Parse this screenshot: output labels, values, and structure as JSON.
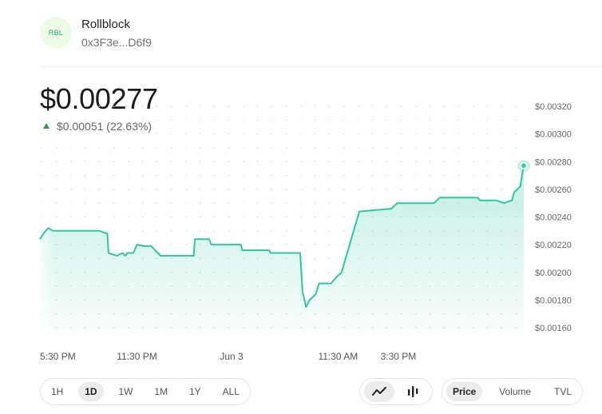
{
  "token": {
    "logo_text": "RBL",
    "name": "Rollblock",
    "address": "0x3F3e...D6f9"
  },
  "price": {
    "value": "$0.00277",
    "change": "$0.00051 (22.63%)",
    "change_direction": "up"
  },
  "colors": {
    "accent": "#2fc7a0",
    "positive": "#2d9c46"
  },
  "chart_data": {
    "type": "line",
    "title": "",
    "xlabel": "",
    "ylabel": "",
    "ylim": [
      0.00155,
      0.00325
    ],
    "y_ticks": [
      "$0.00320",
      "$0.00300",
      "$0.00280",
      "$0.00260",
      "$0.00240",
      "$0.00220",
      "$0.00200",
      "$0.00180",
      "$0.00160"
    ],
    "x_ticks": [
      "5:30 PM",
      "11:30 PM",
      "Jun 3",
      "11:30 AM",
      "3:30 PM"
    ],
    "grid": true,
    "legend": "none",
    "series": [
      {
        "x_hours": [
          0,
          0.3,
          0.7,
          1.1,
          2.6,
          5.0,
          5.7,
          5.8,
          6.5,
          7.0,
          7.2,
          7.4,
          7.9,
          8.2,
          8.8,
          9.4,
          10.2,
          11.6,
          13.0,
          13.1,
          14.3,
          14.5,
          17.0,
          17.1,
          19.4,
          19.5,
          22.0,
          22.2,
          22.5,
          22.8,
          23.3,
          23.6,
          24.0,
          24.6,
          25.0,
          25.5,
          27.0,
          29.7,
          30.2,
          33.3,
          33.8,
          37.0,
          37.2,
          38.6,
          38.9,
          39.3,
          39.5,
          39.9,
          40.1,
          40.6,
          40.9
        ],
        "values": [
          0.00224,
          0.00228,
          0.00232,
          0.0023,
          0.0023,
          0.0023,
          0.00228,
          0.00214,
          0.00212,
          0.00214,
          0.00212,
          0.00214,
          0.00214,
          0.0022,
          0.00219,
          0.00219,
          0.00212,
          0.00212,
          0.00212,
          0.00224,
          0.00224,
          0.0022,
          0.0022,
          0.00216,
          0.00216,
          0.00214,
          0.00214,
          0.00186,
          0.00175,
          0.0018,
          0.00184,
          0.00192,
          0.00192,
          0.00192,
          0.00196,
          0.002,
          0.00244,
          0.00246,
          0.0025,
          0.0025,
          0.00254,
          0.00254,
          0.00252,
          0.00252,
          0.00251,
          0.0025,
          0.00251,
          0.00252,
          0.00258,
          0.00262,
          0.00278
        ],
        "last_value": 0.00277
      }
    ]
  },
  "controls": {
    "ranges": [
      "1H",
      "1D",
      "1W",
      "1M",
      "1Y",
      "ALL"
    ],
    "active_range": "1D",
    "views": [
      {
        "icon": "line-chart-icon",
        "active": true
      },
      {
        "icon": "candlestick-chart-icon",
        "active": false
      }
    ],
    "metrics": [
      "Price",
      "Volume",
      "TVL"
    ],
    "active_metric": "Price"
  }
}
